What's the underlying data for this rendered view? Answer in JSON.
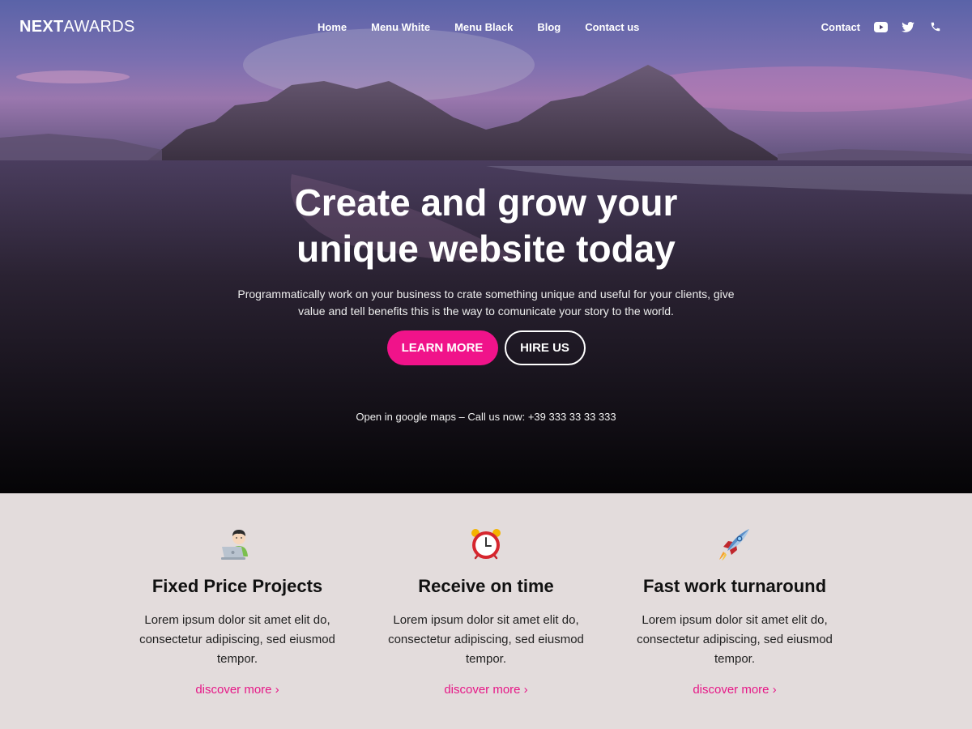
{
  "brand": {
    "logo_bold": "NEXT",
    "logo_light": "AWARDS"
  },
  "nav": {
    "items": [
      {
        "label": "Home"
      },
      {
        "label": "Menu White"
      },
      {
        "label": "Menu Black"
      },
      {
        "label": "Blog"
      },
      {
        "label": "Contact us"
      }
    ],
    "contact_label": "Contact",
    "icons": [
      "youtube-icon",
      "twitter-icon",
      "phone-icon"
    ]
  },
  "hero": {
    "title": "Create and grow your unique website today",
    "subtitle": "Programmatically work on your business to crate something unique and useful for your clients, give value and tell benefits this is the way to comunicate your story to the world.",
    "primary_button": "LEARN MORE",
    "secondary_button": "HIRE US",
    "footer_text": "Open in google maps – Call us now: +39 333 33 33 333"
  },
  "features": [
    {
      "icon": "person-laptop-icon",
      "title": "Fixed Price Projects",
      "text": "Lorem ipsum dolor sit amet elit do, consectetur adipiscing, sed eiusmod tempor.",
      "link": "discover more ›"
    },
    {
      "icon": "alarm-clock-icon",
      "title": "Receive on time",
      "text": "Lorem ipsum dolor sit amet elit do, consectetur adipiscing, sed eiusmod tempor.",
      "link": "discover more ›"
    },
    {
      "icon": "rocket-icon",
      "title": "Fast work turnaround",
      "text": "Lorem ipsum dolor sit amet elit do, consectetur adipiscing, sed eiusmod tempor.",
      "link": "discover more ›"
    }
  ],
  "colors": {
    "accent": "#f0138a",
    "link": "#e61887",
    "features_bg": "#e3dcdc"
  }
}
